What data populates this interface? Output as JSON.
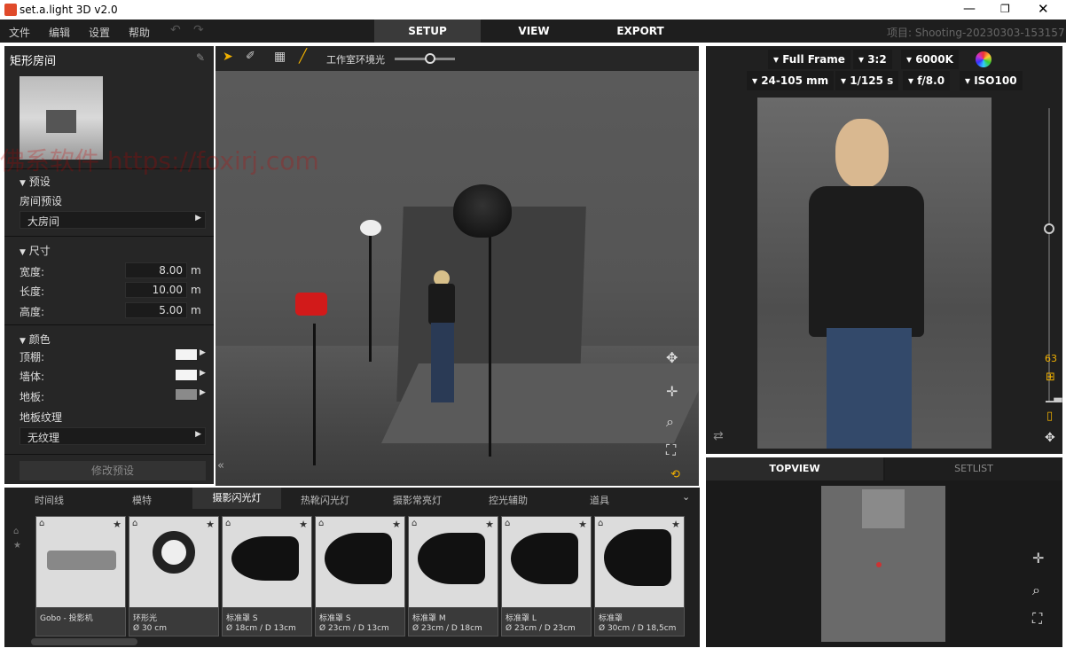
{
  "window": {
    "title": "set.a.light 3D v2.0"
  },
  "menu": {
    "items": [
      "文件",
      "编辑",
      "设置",
      "帮助"
    ],
    "tabs": [
      "SETUP",
      "VIEW",
      "EXPORT"
    ],
    "project": "项目: Shooting-20230303-153157"
  },
  "left": {
    "title": "矩形房间",
    "presets": {
      "header": "预设",
      "label": "房间预设",
      "value": "大房间"
    },
    "size": {
      "header": "尺寸",
      "width_label": "宽度:",
      "width": "8.00",
      "length_label": "长度:",
      "length": "10.00",
      "height_label": "高度:",
      "height": "5.00",
      "unit": "m"
    },
    "color": {
      "header": "颜色",
      "ceiling": "顶棚:",
      "wall": "墙体:",
      "floor": "地板:",
      "texture_label": "地板纹理",
      "texture": "无纹理"
    },
    "modify": "修改预设",
    "ceiling_color": "#f4f4f4",
    "wall_color": "#f4f4f4",
    "floor_color": "#8a8a8a"
  },
  "toolbar": {
    "ambient_label": "工作室环境光"
  },
  "camera": {
    "sensor": "Full Frame",
    "ratio": "3:2",
    "wb": "6000K",
    "lens": "24-105 mm",
    "shutter": "1/125 s",
    "aperture": "f/8.0",
    "iso": "ISO100",
    "zoom": "63"
  },
  "topview": {
    "tabs": [
      "TOPVIEW",
      "SETLIST"
    ]
  },
  "categories": [
    "时间线",
    "模特",
    "摄影闪光灯",
    "热靴闪光灯",
    "摄影常亮灯",
    "控光辅助",
    "道具"
  ],
  "cards": [
    {
      "name": "Gobo - 投影机",
      "size": ""
    },
    {
      "name": "环形光",
      "size": "Ø 30 cm"
    },
    {
      "name": "标准罩 S",
      "size": "Ø 18cm / D 13cm"
    },
    {
      "name": "标准罩 S",
      "size": "Ø 23cm / D 13cm"
    },
    {
      "name": "标准罩 M",
      "size": "Ø 23cm / D 18cm"
    },
    {
      "name": "标准罩 L",
      "size": "Ø 23cm / D 23cm"
    },
    {
      "name": "标准罩",
      "size": "Ø 30cm / D 18,5cm"
    }
  ],
  "watermark": "佛系软件 https://foxirj.com"
}
